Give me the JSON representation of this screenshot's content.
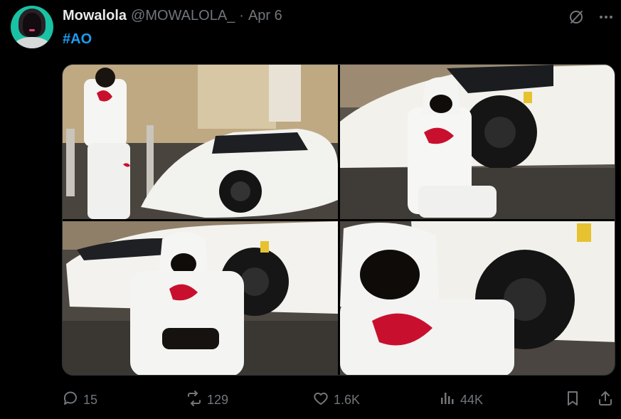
{
  "tweet": {
    "display_name": "Mowalola",
    "handle": "@MOWALOLA_",
    "separator": "·",
    "date": "Apr 6",
    "hashtag": "#AO"
  },
  "actions": {
    "replies": "15",
    "reposts": "129",
    "likes": "1.6K",
    "views": "44K"
  },
  "media": {
    "count": 4,
    "photos": [
      "photo-1",
      "photo-2",
      "photo-3",
      "photo-4"
    ]
  },
  "colors": {
    "background": "#000000",
    "text_primary": "#e7e9ea",
    "text_secondary": "#71767b",
    "link": "#1d9bf0",
    "border": "#2f3336"
  },
  "icons": {
    "top_right": [
      "grok-icon",
      "more-icon"
    ],
    "actions": [
      "reply-icon",
      "repost-icon",
      "like-icon",
      "views-icon",
      "bookmark-icon",
      "share-icon"
    ]
  }
}
